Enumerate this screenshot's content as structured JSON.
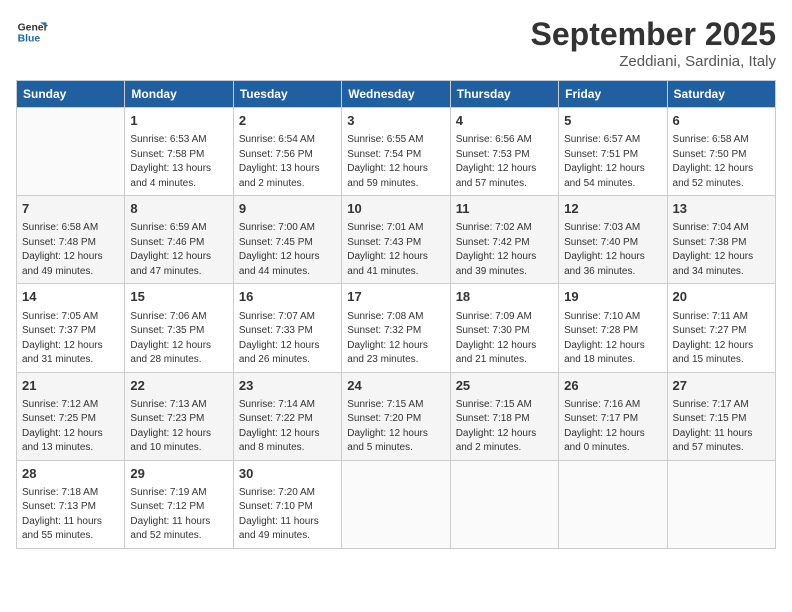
{
  "logo": {
    "line1": "General",
    "line2": "Blue"
  },
  "title": "September 2025",
  "location": "Zeddiani, Sardinia, Italy",
  "days_header": [
    "Sunday",
    "Monday",
    "Tuesday",
    "Wednesday",
    "Thursday",
    "Friday",
    "Saturday"
  ],
  "weeks": [
    [
      {
        "day": "",
        "info": ""
      },
      {
        "day": "1",
        "info": "Sunrise: 6:53 AM\nSunset: 7:58 PM\nDaylight: 13 hours\nand 4 minutes."
      },
      {
        "day": "2",
        "info": "Sunrise: 6:54 AM\nSunset: 7:56 PM\nDaylight: 13 hours\nand 2 minutes."
      },
      {
        "day": "3",
        "info": "Sunrise: 6:55 AM\nSunset: 7:54 PM\nDaylight: 12 hours\nand 59 minutes."
      },
      {
        "day": "4",
        "info": "Sunrise: 6:56 AM\nSunset: 7:53 PM\nDaylight: 12 hours\nand 57 minutes."
      },
      {
        "day": "5",
        "info": "Sunrise: 6:57 AM\nSunset: 7:51 PM\nDaylight: 12 hours\nand 54 minutes."
      },
      {
        "day": "6",
        "info": "Sunrise: 6:58 AM\nSunset: 7:50 PM\nDaylight: 12 hours\nand 52 minutes."
      }
    ],
    [
      {
        "day": "7",
        "info": "Sunrise: 6:58 AM\nSunset: 7:48 PM\nDaylight: 12 hours\nand 49 minutes."
      },
      {
        "day": "8",
        "info": "Sunrise: 6:59 AM\nSunset: 7:46 PM\nDaylight: 12 hours\nand 47 minutes."
      },
      {
        "day": "9",
        "info": "Sunrise: 7:00 AM\nSunset: 7:45 PM\nDaylight: 12 hours\nand 44 minutes."
      },
      {
        "day": "10",
        "info": "Sunrise: 7:01 AM\nSunset: 7:43 PM\nDaylight: 12 hours\nand 41 minutes."
      },
      {
        "day": "11",
        "info": "Sunrise: 7:02 AM\nSunset: 7:42 PM\nDaylight: 12 hours\nand 39 minutes."
      },
      {
        "day": "12",
        "info": "Sunrise: 7:03 AM\nSunset: 7:40 PM\nDaylight: 12 hours\nand 36 minutes."
      },
      {
        "day": "13",
        "info": "Sunrise: 7:04 AM\nSunset: 7:38 PM\nDaylight: 12 hours\nand 34 minutes."
      }
    ],
    [
      {
        "day": "14",
        "info": "Sunrise: 7:05 AM\nSunset: 7:37 PM\nDaylight: 12 hours\nand 31 minutes."
      },
      {
        "day": "15",
        "info": "Sunrise: 7:06 AM\nSunset: 7:35 PM\nDaylight: 12 hours\nand 28 minutes."
      },
      {
        "day": "16",
        "info": "Sunrise: 7:07 AM\nSunset: 7:33 PM\nDaylight: 12 hours\nand 26 minutes."
      },
      {
        "day": "17",
        "info": "Sunrise: 7:08 AM\nSunset: 7:32 PM\nDaylight: 12 hours\nand 23 minutes."
      },
      {
        "day": "18",
        "info": "Sunrise: 7:09 AM\nSunset: 7:30 PM\nDaylight: 12 hours\nand 21 minutes."
      },
      {
        "day": "19",
        "info": "Sunrise: 7:10 AM\nSunset: 7:28 PM\nDaylight: 12 hours\nand 18 minutes."
      },
      {
        "day": "20",
        "info": "Sunrise: 7:11 AM\nSunset: 7:27 PM\nDaylight: 12 hours\nand 15 minutes."
      }
    ],
    [
      {
        "day": "21",
        "info": "Sunrise: 7:12 AM\nSunset: 7:25 PM\nDaylight: 12 hours\nand 13 minutes."
      },
      {
        "day": "22",
        "info": "Sunrise: 7:13 AM\nSunset: 7:23 PM\nDaylight: 12 hours\nand 10 minutes."
      },
      {
        "day": "23",
        "info": "Sunrise: 7:14 AM\nSunset: 7:22 PM\nDaylight: 12 hours\nand 8 minutes."
      },
      {
        "day": "24",
        "info": "Sunrise: 7:15 AM\nSunset: 7:20 PM\nDaylight: 12 hours\nand 5 minutes."
      },
      {
        "day": "25",
        "info": "Sunrise: 7:15 AM\nSunset: 7:18 PM\nDaylight: 12 hours\nand 2 minutes."
      },
      {
        "day": "26",
        "info": "Sunrise: 7:16 AM\nSunset: 7:17 PM\nDaylight: 12 hours\nand 0 minutes."
      },
      {
        "day": "27",
        "info": "Sunrise: 7:17 AM\nSunset: 7:15 PM\nDaylight: 11 hours\nand 57 minutes."
      }
    ],
    [
      {
        "day": "28",
        "info": "Sunrise: 7:18 AM\nSunset: 7:13 PM\nDaylight: 11 hours\nand 55 minutes."
      },
      {
        "day": "29",
        "info": "Sunrise: 7:19 AM\nSunset: 7:12 PM\nDaylight: 11 hours\nand 52 minutes."
      },
      {
        "day": "30",
        "info": "Sunrise: 7:20 AM\nSunset: 7:10 PM\nDaylight: 11 hours\nand 49 minutes."
      },
      {
        "day": "",
        "info": ""
      },
      {
        "day": "",
        "info": ""
      },
      {
        "day": "",
        "info": ""
      },
      {
        "day": "",
        "info": ""
      }
    ]
  ]
}
